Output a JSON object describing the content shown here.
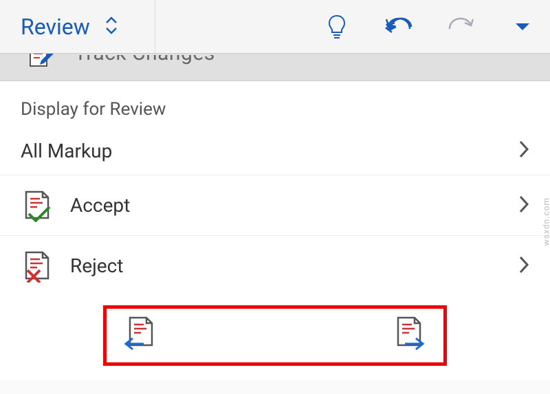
{
  "toolbar": {
    "tab_label": "Review"
  },
  "truncated": {
    "label": "Track Changes"
  },
  "section": {
    "display_label": "Display for Review",
    "markup_value": "All Markup",
    "accept_label": "Accept",
    "reject_label": "Reject"
  },
  "watermark": "wsxdn.com"
}
